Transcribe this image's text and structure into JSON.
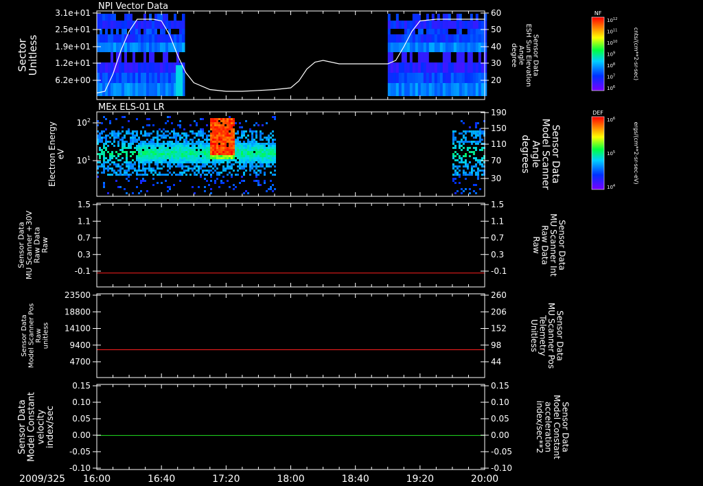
{
  "date_label": "2009/325",
  "x_ticks": [
    "16:00",
    "16:40",
    "17:20",
    "18:00",
    "18:40",
    "19:20",
    "20:00"
  ],
  "colors": {
    "white": "#ffffff",
    "red": "#ff2020",
    "green": "#20e020"
  },
  "chart_data": [
    {
      "type": "heatmap",
      "title": "NPI Vector Data",
      "ylabel": "Sector\nUnitless",
      "y_ticks": [
        "3.1e+01",
        "2.5e+01",
        "1.9e+01",
        "1.2e+01",
        "6.2e+00"
      ],
      "y2_ticks": [
        "60",
        "50",
        "40",
        "30",
        "20"
      ],
      "y2label": "Sensor Data\nESH Sun Elevation\nAngle\ndegree",
      "y2range": [
        10,
        60
      ],
      "colorbar": {
        "label": "NF",
        "ticks": [
          "10^12",
          "10^11",
          "10^10",
          "10^9",
          "10^8",
          "10^7",
          "10^6"
        ],
        "units": "cnts/(cm**2-sr-sec)"
      },
      "data_segments": [
        [
          "16:00",
          "16:54"
        ],
        [
          "19:00",
          "20:00"
        ]
      ],
      "line": {
        "name": "ESH Sun Elevation Angle",
        "x": [
          "16:00",
          "16:05",
          "16:10",
          "16:15",
          "16:20",
          "16:25",
          "16:30",
          "16:35",
          "16:40",
          "16:45",
          "16:50",
          "16:55",
          "17:00",
          "17:10",
          "17:20",
          "17:30",
          "17:40",
          "17:50",
          "18:00",
          "18:05",
          "18:10",
          "18:15",
          "18:20",
          "18:25",
          "18:30",
          "18:40",
          "18:50",
          "19:00",
          "19:05",
          "19:10",
          "19:15",
          "19:20",
          "19:30",
          "19:40",
          "19:50",
          "20:00"
        ],
        "y": [
          13,
          14,
          24,
          38,
          49,
          56,
          56,
          56,
          55,
          47,
          35,
          25,
          19,
          15,
          14,
          14,
          14.5,
          15,
          16,
          20,
          27,
          31,
          32,
          31,
          30,
          30,
          30,
          30,
          32,
          40,
          49,
          55,
          56,
          56,
          56,
          56
        ]
      }
    },
    {
      "type": "heatmap",
      "title": "MEx ELS-01 LR",
      "ylabel": "Electron Energy\neV",
      "y_ticks": [
        "10^2",
        "10^1"
      ],
      "y2_ticks": [
        "190",
        "150",
        "110",
        "70",
        "30"
      ],
      "y2label": "Sensor Data\nModel Scanner\nAngle\ndegrees",
      "colorbar": {
        "label": "DEF",
        "ticks": [
          "10^6",
          "10^5",
          "10^4"
        ],
        "units": "ergs/(cm**2-sr-sec-eV)"
      },
      "data_segments": [
        [
          "16:00",
          "17:50"
        ],
        [
          "19:40",
          "20:00"
        ]
      ],
      "hot_region": [
        "17:10",
        "17:25"
      ]
    },
    {
      "type": "line",
      "ylabel": "Sensor Data\nMU Scanner +30V\nRaw Data\nRaw",
      "y_ticks": [
        "1.5",
        "1.1",
        "0.7",
        "0.3",
        "-0.1"
      ],
      "y2_ticks": [
        "1.5",
        "1.1",
        "0.7",
        "0.3",
        "-0.1"
      ],
      "y2label": "Sensor Data\nMU Scanner Int\nRaw Data\nRaw",
      "ylim": [
        -0.3,
        1.5
      ],
      "series": [
        {
          "name": "",
          "value": 0.0,
          "color": "#ff2020"
        }
      ]
    },
    {
      "type": "line",
      "ylabel": "Sensor Data\nModel Scanner Pos\nRaw\nunitless",
      "y_ticks": [
        "23500",
        "18800",
        "14100",
        "9400",
        "4700"
      ],
      "y2_ticks": [
        "260",
        "206",
        "152",
        "98",
        "44"
      ],
      "y2label": "Sensor Data\nMU Scanner Pos\nTelemetry\nUnitless",
      "ylim": [
        0,
        23500
      ],
      "series": [
        {
          "name": "",
          "value": 7800,
          "color": "#ff2020"
        }
      ]
    },
    {
      "type": "line",
      "ylabel": "Sensor Data\nModel Constant\nvelocity\nindex/sec",
      "y_ticks": [
        "0.15",
        "0.10",
        "0.05",
        "0.00",
        "-0.05",
        "-0.10"
      ],
      "y2_ticks": [
        "0.15",
        "0.10",
        "0.05",
        "0.00",
        "-0.05",
        "-0.10"
      ],
      "y2label": "Sensor Data\nModel Constant\nacceleration\nindex/sec**2",
      "ylim": [
        -0.1,
        0.15
      ],
      "series": [
        {
          "name": "",
          "value": 0.0,
          "color": "#20e020"
        }
      ]
    }
  ]
}
